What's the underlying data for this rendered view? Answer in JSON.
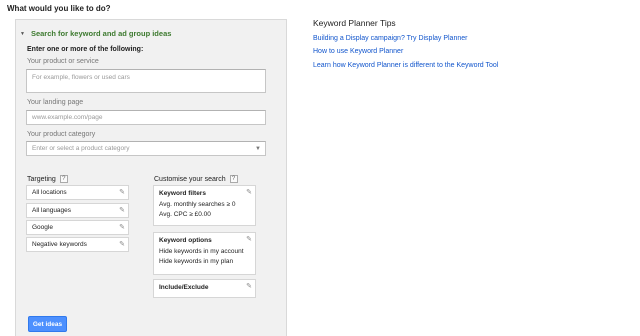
{
  "header": {
    "question": "What would you like to do?"
  },
  "panel": {
    "toggle_label": "Search for keyword and ad group ideas",
    "intro": "Enter one or more of the following:",
    "product": {
      "label": "Your product or service",
      "placeholder": "For example, flowers or used cars"
    },
    "landing": {
      "label": "Your landing page",
      "placeholder": "www.example.com/page"
    },
    "category": {
      "label": "Your product category",
      "placeholder": "Enter or select a product category"
    },
    "targeting": {
      "label": "Targeting",
      "help": "?",
      "items": [
        {
          "label": "All locations"
        },
        {
          "label": "All languages"
        },
        {
          "label": "Google"
        },
        {
          "label": "Negative keywords"
        }
      ]
    },
    "customise": {
      "label": "Customise your search",
      "help": "?",
      "keyword_filters": {
        "title": "Keyword filters",
        "lines": [
          "Avg. monthly searches ≥ 0",
          "Avg. CPC ≥ £0.00"
        ]
      },
      "keyword_options": {
        "title": "Keyword options",
        "lines": [
          "Hide keywords in my account",
          "Hide keywords in my plan"
        ]
      },
      "include_exclude": {
        "title": "Include/Exclude"
      }
    },
    "get_ideas_label": "Get ideas"
  },
  "tips": {
    "title": "Keyword Planner Tips",
    "links": [
      "Building a Display campaign? Try Display Planner",
      "How to use Keyword Planner",
      "Learn how Keyword Planner is different to the Keyword Tool"
    ]
  },
  "icons": {
    "edit": "pencil-icon",
    "toggle": "triangle-down-icon",
    "dropdown": "chevron-down-icon"
  },
  "colors": {
    "primary_button": "#4d90fe",
    "link": "#1155cc",
    "section_green": "#3d7a2f"
  }
}
